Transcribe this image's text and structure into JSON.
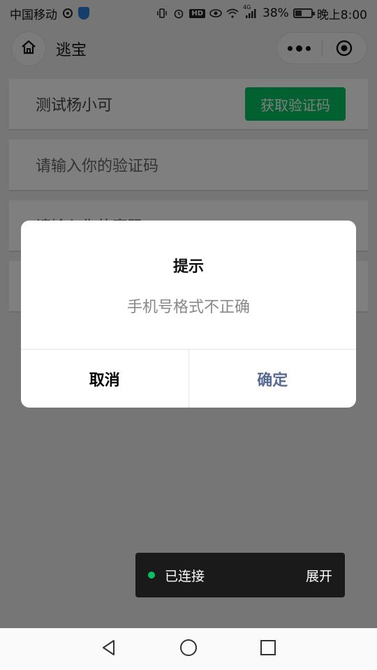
{
  "status_bar": {
    "carrier": "中国移动",
    "battery": "38%",
    "battery_level": 0.38,
    "time": "晚上8:00",
    "network_badge": "4G",
    "hd_badge": "HD"
  },
  "navbar": {
    "title": "逃宝",
    "home_icon": "home-icon",
    "more_icon": "more-dots-icon",
    "close_icon": "target-icon"
  },
  "form": {
    "phone_value": "测试杨小可",
    "get_code_label": "获取验证码",
    "code_placeholder": "请输入你的验证码",
    "third_row_partial": "请输入你的密码"
  },
  "dialog": {
    "title": "提示",
    "message": "手机号格式不正确",
    "cancel_label": "取消",
    "confirm_label": "确定"
  },
  "toast": {
    "status": "已连接",
    "action": "展开"
  },
  "colors": {
    "accent_green": "#07c160",
    "confirm_blue": "#576b95"
  }
}
